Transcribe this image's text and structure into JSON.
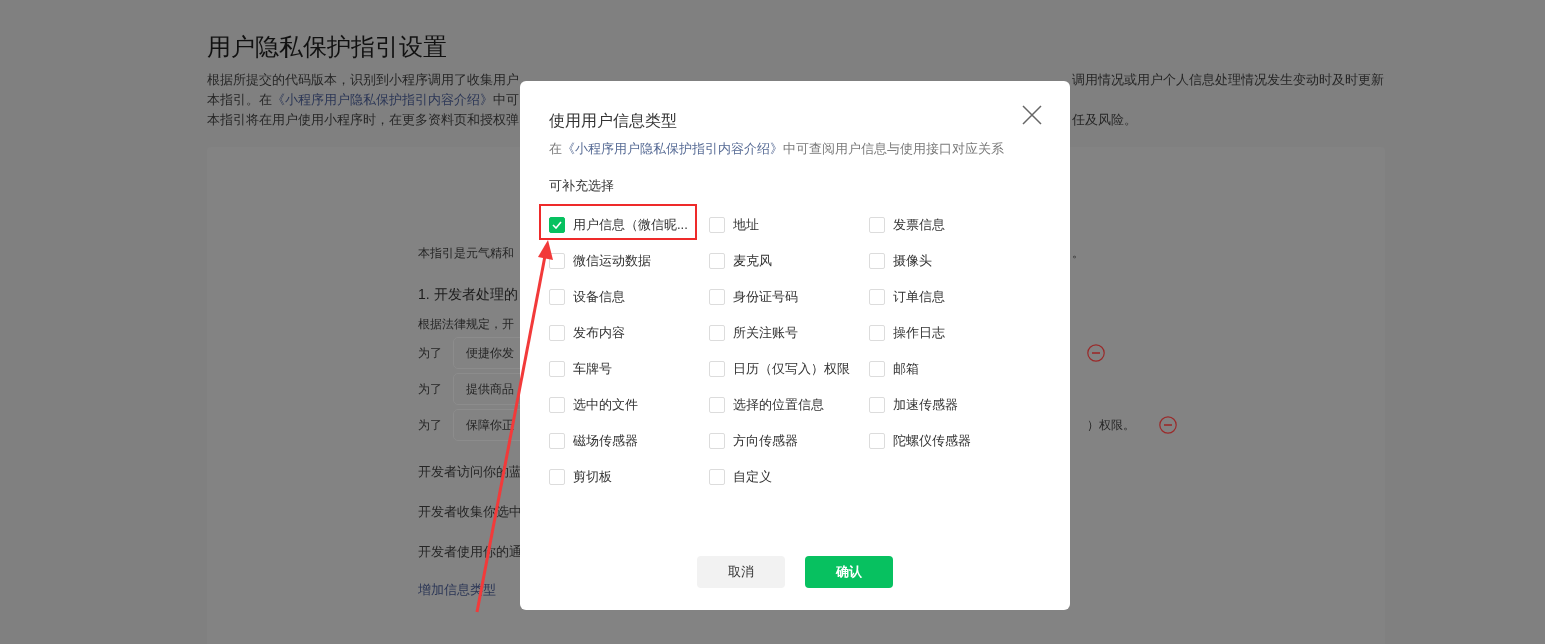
{
  "page": {
    "title": "用户隐私保护指引设置",
    "intro_lines": [
      {
        "left": [
          {
            "kind": "text",
            "text": "根据所提交的代码版本，识别到小程序调用了收集用户"
          }
        ],
        "right": "调用情况或用户个人信息处理情况发生变动时及时更新"
      },
      {
        "left": [
          {
            "kind": "text",
            "text": "本指引。在"
          },
          {
            "kind": "link",
            "text": "《小程序用户隐私保护指引内容介绍》"
          },
          {
            "kind": "text",
            "text": "中可"
          }
        ]
      },
      {
        "left": [
          {
            "kind": "text",
            "text": "本指引将在用户使用小程序时，在更多资料页和授权弹"
          }
        ],
        "right": "任及风险。"
      }
    ]
  },
  "guide": {
    "intro": "本指引是元气精和",
    "intro_end": "。",
    "section_title": "1. 开发者处理的",
    "law_text": "根据法律规定，开",
    "purposes": [
      {
        "prefix": "为了",
        "value": "便捷你发",
        "remove_icon": true
      },
      {
        "prefix": "为了",
        "value": "提供商品",
        "remove_icon": false
      },
      {
        "prefix": "为了",
        "value": "保障你正",
        "suffix": "）权限。",
        "remove_icon": true
      }
    ],
    "statements": [
      "开发者访问你的蓝",
      "开发者收集你选中",
      "开发者使用你的通"
    ],
    "add_link": "增加信息类型"
  },
  "dialog": {
    "title": "使用用户信息类型",
    "hint": [
      {
        "kind": "text",
        "text": "在"
      },
      {
        "kind": "link",
        "text": "《小程序用户隐私保护指引内容介绍》"
      },
      {
        "kind": "text",
        "text": "中可查阅用户信息与使用接口对应关系"
      }
    ],
    "section": "可补充选择",
    "options": [
      {
        "label": "用户信息（微信昵...",
        "checked": true
      },
      {
        "label": "地址",
        "checked": false
      },
      {
        "label": "发票信息",
        "checked": false
      },
      {
        "label": "微信运动数据",
        "checked": false
      },
      {
        "label": "麦克风",
        "checked": false
      },
      {
        "label": "摄像头",
        "checked": false
      },
      {
        "label": "设备信息",
        "checked": false
      },
      {
        "label": "身份证号码",
        "checked": false
      },
      {
        "label": "订单信息",
        "checked": false
      },
      {
        "label": "发布内容",
        "checked": false
      },
      {
        "label": "所关注账号",
        "checked": false
      },
      {
        "label": "操作日志",
        "checked": false
      },
      {
        "label": "车牌号",
        "checked": false
      },
      {
        "label": "日历（仅写入）权限",
        "checked": false
      },
      {
        "label": "邮箱",
        "checked": false
      },
      {
        "label": "选中的文件",
        "checked": false
      },
      {
        "label": "选择的位置信息",
        "checked": false
      },
      {
        "label": "加速传感器",
        "checked": false
      },
      {
        "label": "磁场传感器",
        "checked": false
      },
      {
        "label": "方向传感器",
        "checked": false
      },
      {
        "label": "陀螺仪传感器",
        "checked": false
      },
      {
        "label": "剪切板",
        "checked": false
      },
      {
        "label": "自定义",
        "checked": false
      }
    ],
    "buttons": [
      {
        "label": "取消",
        "kind": "secondary"
      },
      {
        "label": "确认",
        "kind": "primary"
      }
    ]
  }
}
